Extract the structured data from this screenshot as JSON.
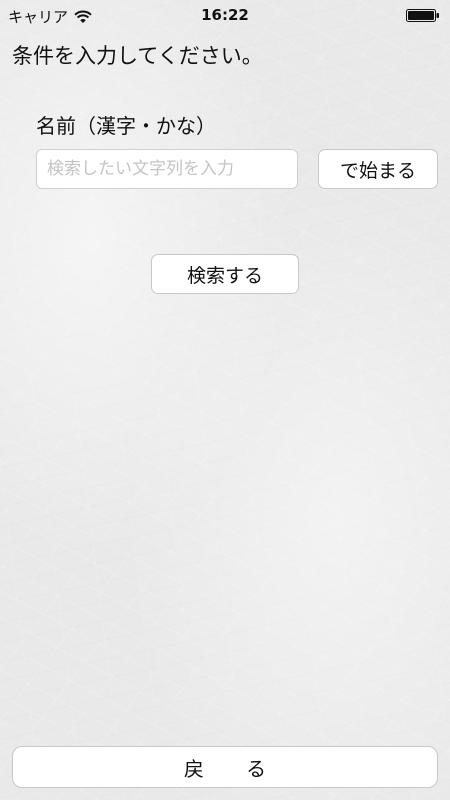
{
  "status_bar": {
    "carrier": "キャリア",
    "time": "16:22",
    "wifi_icon": "wifi-icon",
    "battery_icon": "battery-icon"
  },
  "title": "条件を入力してください。",
  "name_field": {
    "label": "名前（漢字・かな）",
    "value": "",
    "placeholder": "検索したい文字列を入力"
  },
  "match_mode_button": "で始まる",
  "search_button": "検索する",
  "back_button": "戻 る"
}
